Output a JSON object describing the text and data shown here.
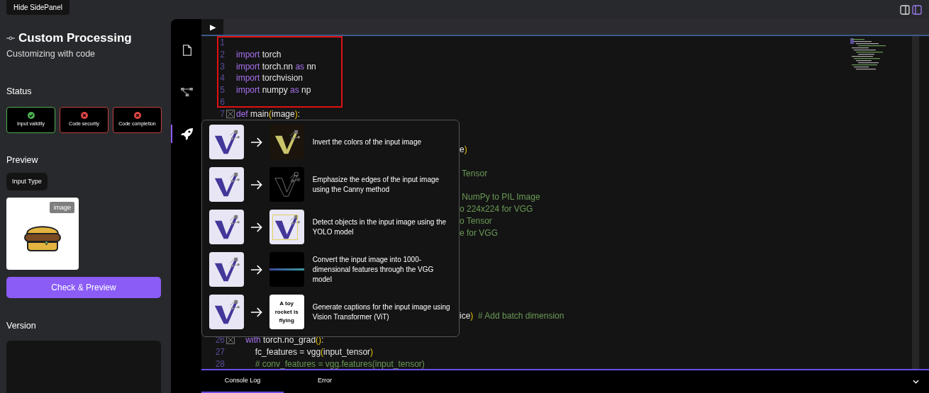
{
  "header": {
    "toggle_button": "Hide SidePanel"
  },
  "sidebar": {
    "title": "Custom Processing",
    "subtitle": "Customizing with code",
    "status": {
      "heading": "Status",
      "items": [
        {
          "label": "Input validity",
          "ok": true
        },
        {
          "label": "Code security",
          "ok": false
        },
        {
          "label": "Code completion",
          "ok": false
        }
      ]
    },
    "preview": {
      "heading": "Preview",
      "input_type": "Input Type",
      "tag": "image",
      "button": "Check & Preview"
    },
    "version": {
      "heading": "Version"
    }
  },
  "rail": [
    {
      "kind": "file",
      "selected": false
    },
    {
      "kind": "graph",
      "selected": false
    },
    {
      "kind": "rocket",
      "selected": true
    }
  ],
  "editor": {
    "run_tab": "▶",
    "lines": [
      {
        "kind": "line",
        "number": "1",
        "foldable": false
      },
      {
        "kind": "line",
        "number": "2",
        "foldable": false,
        "tokens": [
          {
            "kind": "keyword",
            "text": "import"
          },
          {
            "kind": "name",
            "text": " torch"
          }
        ]
      },
      {
        "kind": "line",
        "number": "3",
        "foldable": false,
        "tokens": [
          {
            "kind": "keyword",
            "text": "import"
          },
          {
            "kind": "name",
            "text": " torch.nn "
          },
          {
            "kind": "keyword",
            "text": "as"
          },
          {
            "kind": "name",
            "text": " nn"
          }
        ]
      },
      {
        "kind": "line",
        "number": "4",
        "foldable": false,
        "tokens": [
          {
            "kind": "keyword",
            "text": "import"
          },
          {
            "kind": "name",
            "text": " torchvision"
          }
        ]
      },
      {
        "kind": "line",
        "number": "5",
        "foldable": false,
        "tokens": [
          {
            "kind": "keyword",
            "text": "import"
          },
          {
            "kind": "name",
            "text": " numpy "
          },
          {
            "kind": "keyword",
            "text": "as"
          },
          {
            "kind": "name",
            "text": " np"
          }
        ]
      },
      {
        "kind": "line",
        "number": "6",
        "foldable": false
      },
      {
        "kind": "line",
        "number": "7",
        "foldable": true,
        "tokens": [
          {
            "kind": "keyword",
            "text": "def"
          },
          {
            "kind": "name",
            "text": " main"
          },
          {
            "kind": "paren",
            "text": "("
          },
          {
            "kind": "name",
            "text": "image"
          },
          {
            "kind": "paren",
            "text": ")"
          },
          {
            "kind": "name",
            "text": ":"
          }
        ]
      },
      {
        "kind": "fragment"
      },
      {
        "kind": "fragment"
      },
      {
        "kind": "fragment",
        "tokens": [
          {
            "kind": "name",
            "text": "e"
          },
          {
            "kind": "paren",
            "text": ")"
          }
        ]
      },
      {
        "kind": "fragment"
      },
      {
        "kind": "fragment",
        "tokens": [
          {
            "kind": "comment",
            "text": " Tensor"
          }
        ]
      },
      {
        "kind": "fragment"
      },
      {
        "kind": "fragment",
        "tokens": [
          {
            "kind": "comment",
            "text": " NumPy to PIL Image"
          }
        ]
      },
      {
        "kind": "fragment",
        "tokens": [
          {
            "kind": "comment",
            "text": "o 224x224 for VGG"
          }
        ]
      },
      {
        "kind": "fragment",
        "tokens": [
          {
            "kind": "comment",
            "text": "o Tensor"
          }
        ]
      },
      {
        "kind": "fragment",
        "tokens": [
          {
            "kind": "comment",
            "text": "e for VGG"
          }
        ]
      },
      {
        "kind": "fragment"
      },
      {
        "kind": "fragment"
      },
      {
        "kind": "fragment"
      },
      {
        "kind": "fragment"
      },
      {
        "kind": "fragment"
      },
      {
        "kind": "fragment"
      },
      {
        "kind": "fragment",
        "tokens": [
          {
            "kind": "name",
            "text": "ice"
          },
          {
            "kind": "paren",
            "text": ")"
          },
          {
            "kind": "comment",
            "text": "  # Add batch dimension"
          }
        ]
      },
      {
        "kind": "fragment"
      },
      {
        "kind": "line",
        "number": "26",
        "foldable": true,
        "tokens": [
          {
            "kind": "keyword",
            "text": "    with"
          },
          {
            "kind": "name",
            "text": " torch.no_grad"
          },
          {
            "kind": "paren",
            "text": "()"
          },
          {
            "kind": "name",
            "text": ":"
          }
        ]
      },
      {
        "kind": "line",
        "number": "27",
        "foldable": false,
        "tokens": [
          {
            "kind": "name",
            "text": "        fc_features = vgg"
          },
          {
            "kind": "paren",
            "text": "("
          },
          {
            "kind": "name",
            "text": "input_tensor"
          },
          {
            "kind": "paren",
            "text": ")"
          }
        ]
      },
      {
        "kind": "line",
        "number": "28",
        "foldable": false,
        "tokens": [
          {
            "kind": "comment",
            "text": "        # conv_features = vgg.features(input_tensor)"
          }
        ]
      }
    ]
  },
  "examples": [
    {
      "kind": "inverted",
      "description": "Invert the colors of the input image"
    },
    {
      "kind": "edges",
      "description": "Emphasize the edges of the input image using the Canny method"
    },
    {
      "kind": "detection",
      "description": "Detect objects in the input image using the YOLO model"
    },
    {
      "kind": "features",
      "description": "Convert the input image into 1000-dimensional features through the VGG model"
    },
    {
      "kind": "caption",
      "caption": "A toy rocket is flying",
      "description": "Generate captions for the input image using Vision Transformer (ViT)"
    }
  ],
  "console": {
    "tabs": [
      {
        "label": "Console Log",
        "selected": true
      },
      {
        "label": "Error",
        "selected": false
      }
    ]
  }
}
